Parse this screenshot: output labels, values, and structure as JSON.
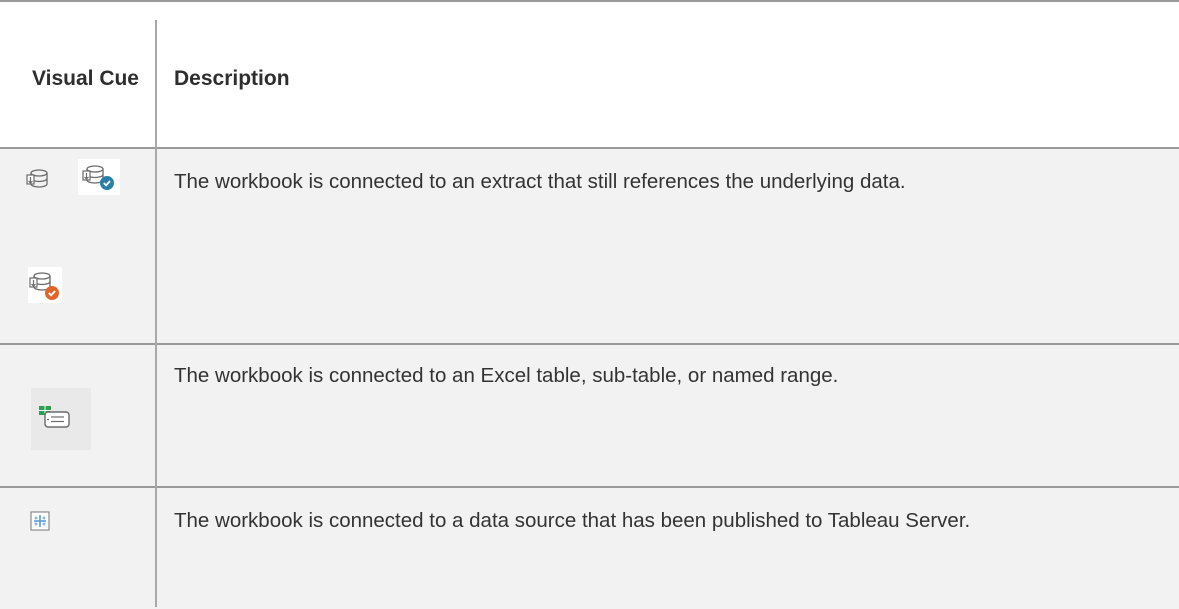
{
  "table": {
    "headers": {
      "visual_cue": "Visual Cue",
      "description": "Description"
    },
    "rows": [
      {
        "icons": [
          "extract-icon",
          "extract-refresh-success-icon",
          "extract-refresh-warning-icon"
        ],
        "description": "The workbook is connected to an extract that still references the underlying data."
      },
      {
        "icons": [
          "excel-named-range-icon"
        ],
        "description": "The workbook is connected to an Excel table, sub-table, or named range."
      },
      {
        "icons": [
          "published-data-source-icon"
        ],
        "description": "The workbook is connected to a data source that has been published to Tableau Server."
      }
    ]
  },
  "colors": {
    "row_background": "#f2f2f2",
    "border": "#9a9a9a",
    "success_badge": "#2a7fa8",
    "warning_badge": "#e0652a",
    "excel_green": "#2e9e4f",
    "server_blue": "#5b9bd5"
  }
}
